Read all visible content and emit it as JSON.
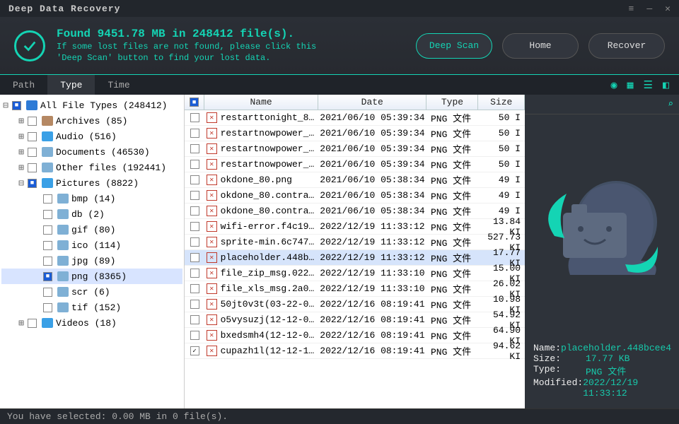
{
  "title": "Deep Data Recovery",
  "header": {
    "found_line": "Found 9451.78 MB in 248412 file(s).",
    "hint_line1": "If some lost files are not found, please click this",
    "hint_line2": "'Deep Scan' button to find your lost data.",
    "deep_scan": "Deep Scan",
    "home": "Home",
    "recover": "Recover"
  },
  "tabs": {
    "path": "Path",
    "type": "Type",
    "time": "Time"
  },
  "tree": [
    {
      "depth": 0,
      "exp": "⊟",
      "chk": "filled",
      "icon": "#2e7bd6",
      "label": "All File Types (248412)",
      "name": "all-file-types"
    },
    {
      "depth": 1,
      "exp": "⊞",
      "chk": "",
      "icon": "#b58863",
      "label": "Archives (85)",
      "name": "archives"
    },
    {
      "depth": 1,
      "exp": "⊞",
      "chk": "",
      "icon": "#3aa0e6",
      "label": "Audio (516)",
      "name": "audio"
    },
    {
      "depth": 1,
      "exp": "⊞",
      "chk": "",
      "icon": "#7fb0d5",
      "label": "Documents (46530)",
      "name": "documents"
    },
    {
      "depth": 1,
      "exp": "⊞",
      "chk": "",
      "icon": "#7fb0d5",
      "label": "Other files (192441)",
      "name": "other-files"
    },
    {
      "depth": 1,
      "exp": "⊟",
      "chk": "filled",
      "icon": "#3aa0e6",
      "label": "Pictures (8822)",
      "name": "pictures"
    },
    {
      "depth": 2,
      "exp": " ",
      "chk": "",
      "icon": "#7fb0d5",
      "label": "bmp (14)",
      "name": "bmp"
    },
    {
      "depth": 2,
      "exp": " ",
      "chk": "",
      "icon": "#7fb0d5",
      "label": "db (2)",
      "name": "db"
    },
    {
      "depth": 2,
      "exp": " ",
      "chk": "",
      "icon": "#7fb0d5",
      "label": "gif (80)",
      "name": "gif"
    },
    {
      "depth": 2,
      "exp": " ",
      "chk": "",
      "icon": "#7fb0d5",
      "label": "ico (114)",
      "name": "ico"
    },
    {
      "depth": 2,
      "exp": " ",
      "chk": "",
      "icon": "#7fb0d5",
      "label": "jpg (89)",
      "name": "jpg"
    },
    {
      "depth": 2,
      "exp": " ",
      "chk": "filled",
      "icon": "#7fb0d5",
      "label": "png (8365)",
      "name": "png",
      "sel": true
    },
    {
      "depth": 2,
      "exp": " ",
      "chk": "",
      "icon": "#7fb0d5",
      "label": "scr (6)",
      "name": "scr"
    },
    {
      "depth": 2,
      "exp": " ",
      "chk": "",
      "icon": "#7fb0d5",
      "label": "tif (152)",
      "name": "tif"
    },
    {
      "depth": 1,
      "exp": "⊞",
      "chk": "",
      "icon": "#3aa0e6",
      "label": "Videos (18)",
      "name": "videos"
    }
  ],
  "columns": {
    "name": "Name",
    "date": "Date",
    "type": "Type",
    "size": "Size"
  },
  "files": [
    {
      "chk": "",
      "name": "restarttonight_8...",
      "date": "2021/06/10 05:39:34",
      "type": "PNG 文件",
      "size": "50 ",
      "kb": "I"
    },
    {
      "chk": "",
      "name": "restartnowpower_...",
      "date": "2021/06/10 05:39:34",
      "type": "PNG 文件",
      "size": "50 ",
      "kb": "I"
    },
    {
      "chk": "",
      "name": "restartnowpower_...",
      "date": "2021/06/10 05:39:34",
      "type": "PNG 文件",
      "size": "50 ",
      "kb": "I"
    },
    {
      "chk": "",
      "name": "restartnowpower_...",
      "date": "2021/06/10 05:39:34",
      "type": "PNG 文件",
      "size": "50 ",
      "kb": "I"
    },
    {
      "chk": "",
      "name": "okdone_80.png",
      "date": "2021/06/10 05:38:34",
      "type": "PNG 文件",
      "size": "49 ",
      "kb": "I"
    },
    {
      "chk": "",
      "name": "okdone_80.contra...",
      "date": "2021/06/10 05:38:34",
      "type": "PNG 文件",
      "size": "49 ",
      "kb": "I"
    },
    {
      "chk": "",
      "name": "okdone_80.contra...",
      "date": "2021/06/10 05:38:34",
      "type": "PNG 文件",
      "size": "49 ",
      "kb": "I"
    },
    {
      "chk": "",
      "name": "wifi-error.f4c19...",
      "date": "2022/12/19 11:33:12",
      "type": "PNG 文件",
      "size": "13.84 ",
      "kb": "KI"
    },
    {
      "chk": "",
      "name": "sprite-min.6c747...",
      "date": "2022/12/19 11:33:12",
      "type": "PNG 文件",
      "size": "527.73 ",
      "kb": "KI"
    },
    {
      "chk": "",
      "name": "placeholder.448b...",
      "date": "2022/12/19 11:33:12",
      "type": "PNG 文件",
      "size": "17.77 ",
      "kb": "KI",
      "sel": true
    },
    {
      "chk": "",
      "name": "file_zip_msg.022...",
      "date": "2022/12/19 11:33:10",
      "type": "PNG 文件",
      "size": "15.00 ",
      "kb": "KI"
    },
    {
      "chk": "",
      "name": "file_xls_msg.2a0...",
      "date": "2022/12/19 11:33:10",
      "type": "PNG 文件",
      "size": "26.02 ",
      "kb": "KI"
    },
    {
      "chk": "",
      "name": "50jt0v3t(03-22-0...",
      "date": "2022/12/16 08:19:41",
      "type": "PNG 文件",
      "size": "10.98 ",
      "kb": "KI"
    },
    {
      "chk": "",
      "name": "o5vysuzj(12-12-0...",
      "date": "2022/12/16 08:19:41",
      "type": "PNG 文件",
      "size": "54.92 ",
      "kb": "KI"
    },
    {
      "chk": "",
      "name": "bxedsmh4(12-12-0...",
      "date": "2022/12/16 08:19:41",
      "type": "PNG 文件",
      "size": "64.90 ",
      "kb": "KI"
    },
    {
      "chk": "✓",
      "name": "cupazh1l(12-12-1...",
      "date": "2022/12/16 08:19:41",
      "type": "PNG 文件",
      "size": "94.62 ",
      "kb": "KI"
    }
  ],
  "preview": {
    "name_k": "Name:",
    "name_v": "placeholder.448bcee4",
    "size_k": "Size:",
    "size_v": "17.77 KB",
    "type_k": "Type:",
    "type_v": "PNG 文件",
    "mod_k": "Modified:",
    "mod_v": "2022/12/19 11:33:12"
  },
  "status": "You have selected: 0.00 MB in 0 file(s)."
}
